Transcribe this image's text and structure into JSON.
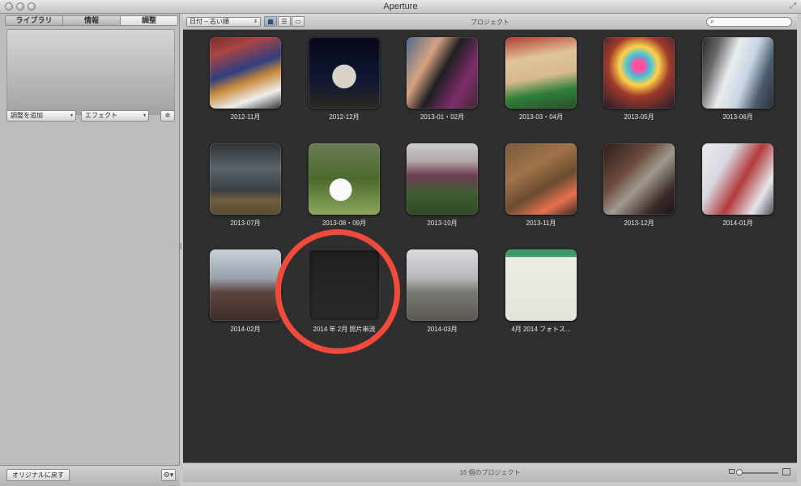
{
  "window": {
    "title": "Aperture"
  },
  "inspector": {
    "tabs": [
      {
        "label": "ライブラリ"
      },
      {
        "label": "情報"
      },
      {
        "label": "調整",
        "active": true
      }
    ],
    "add_adjustment_label": "調整を追加",
    "effects_label": "エフェクト",
    "revert_label": "オリジナルに戻す"
  },
  "browser": {
    "sort_label": "日付 – 古い順",
    "title": "プロジェクト",
    "search_placeholder": "",
    "status": "16 個のプロジェクト",
    "projects": [
      {
        "label": "2012-11月"
      },
      {
        "label": "2012-12月"
      },
      {
        "label": "2013-01・02月"
      },
      {
        "label": "2013-03・04月"
      },
      {
        "label": "2013-05月"
      },
      {
        "label": "2013-06月"
      },
      {
        "label": "2013-07月"
      },
      {
        "label": "2013-08・09月"
      },
      {
        "label": "2013-10月"
      },
      {
        "label": "2013-11月"
      },
      {
        "label": "2013-12月"
      },
      {
        "label": "2014-01月"
      },
      {
        "label": "2014-02月"
      },
      {
        "label": "2014 年 2月 照片串流"
      },
      {
        "label": "2014-03月"
      },
      {
        "label": "4月 2014 フォトス..."
      }
    ]
  },
  "colors": {
    "annotation_circle": "#ef4a3a",
    "browser_background": "#2f2f2f"
  }
}
